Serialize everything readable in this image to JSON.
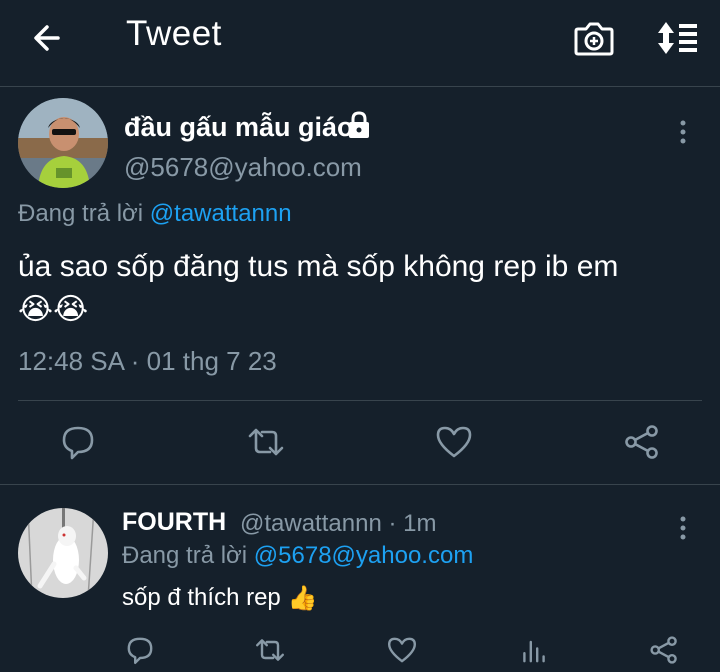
{
  "header": {
    "title": "Tweet",
    "back_icon": "arrow-left-icon",
    "camera_icon": "camera-plus-icon",
    "sort_icon": "sort-icon"
  },
  "tweet": {
    "author_name": "đầu gấu mẫu giáo",
    "author_handle": "@5678@yahoo.com",
    "reply_prefix": "Đang trả lời",
    "reply_to": "@tawattannn",
    "text": "ủa sao sốp đăng tus mà sốp không rep ib em",
    "emoji": [
      "😭",
      "😭"
    ],
    "timestamp": "12:48 SA · 01 thg 7 23"
  },
  "reply": {
    "author_name": "FOURTH",
    "meta": "@tawattannn · 1m",
    "reply_prefix": "Đang trả lời",
    "reply_to": "@5678@yahoo.com",
    "text": "sốp đ thích rep",
    "emoji": "👍"
  },
  "colors": {
    "background": "#15202b",
    "muted": "#8899a6",
    "link": "#1da1f2",
    "divider": "#38444d"
  }
}
